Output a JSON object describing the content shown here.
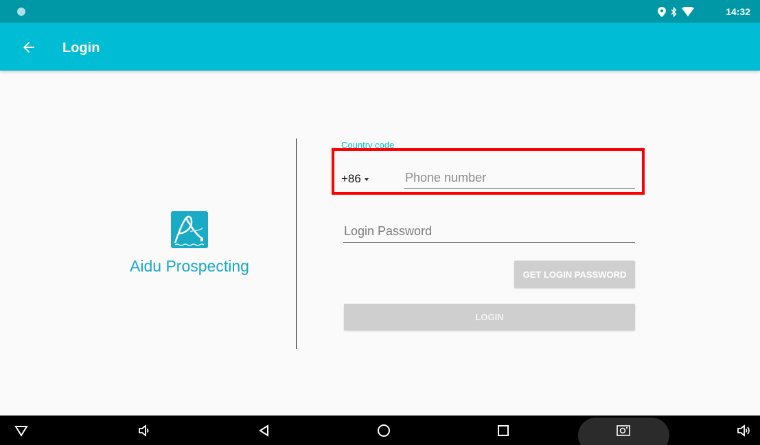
{
  "status_bar": {
    "time": "14:32",
    "icons": [
      "location-icon",
      "bluetooth-icon",
      "wifi-icon"
    ]
  },
  "app_bar": {
    "title": "Login",
    "back_icon": "arrow-left-icon"
  },
  "brand": {
    "name": "Aidu Prospecting",
    "logo_icon": "aidu-logo-icon"
  },
  "form": {
    "country_code_label": "Country code",
    "country_code_value": "+86",
    "phone_placeholder": "Phone number",
    "phone_value": "",
    "password_placeholder": "Login Password",
    "password_value": "",
    "get_password_label": "GET LOGIN PASSWORD",
    "login_label": "LOGIN"
  },
  "nav_bar": {
    "items": [
      "hide-nav-icon",
      "volume-down-icon",
      "back-icon",
      "home-icon",
      "recents-icon",
      "screenshot-icon",
      "volume-up-icon"
    ]
  },
  "colors": {
    "status_bar": "#0097a7",
    "app_bar": "#00bcd4",
    "accent": "#00bcd4",
    "brand_text": "#1aa8c3",
    "disabled_button": "#cfcfcf",
    "highlight": "#ff0000"
  }
}
